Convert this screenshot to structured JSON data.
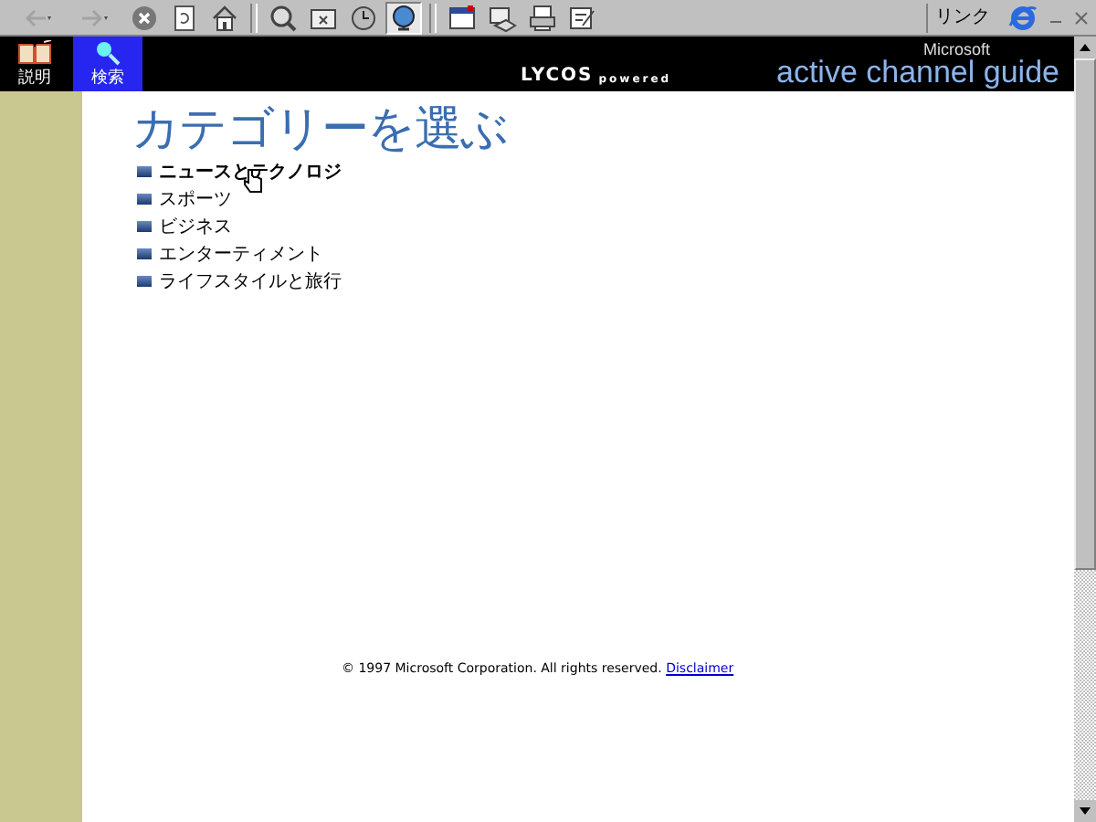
{
  "toolbar": {
    "buttons": [
      {
        "kind": "back",
        "disabled": true,
        "pressed": false
      },
      {
        "kind": "forward",
        "disabled": true,
        "pressed": false
      },
      {
        "kind": "stop",
        "disabled": false,
        "pressed": false
      },
      {
        "kind": "refresh",
        "disabled": false,
        "pressed": false
      },
      {
        "kind": "home",
        "disabled": false,
        "pressed": false
      },
      {
        "kind": "sep"
      },
      {
        "kind": "search",
        "disabled": false,
        "pressed": false
      },
      {
        "kind": "favorites",
        "disabled": false,
        "pressed": false
      },
      {
        "kind": "history",
        "disabled": false,
        "pressed": false
      },
      {
        "kind": "channels",
        "disabled": false,
        "pressed": true
      },
      {
        "kind": "sep"
      },
      {
        "kind": "fullscreen",
        "disabled": false,
        "pressed": false
      },
      {
        "kind": "mail",
        "disabled": false,
        "pressed": false
      },
      {
        "kind": "print",
        "disabled": false,
        "pressed": false
      },
      {
        "kind": "edit",
        "disabled": false,
        "pressed": false
      }
    ],
    "links_label": "リンク"
  },
  "explorer_bar": {
    "tabs": [
      {
        "label": "説明",
        "kind": "book",
        "selected": false
      },
      {
        "label": "検索",
        "kind": "search",
        "selected": true
      }
    ]
  },
  "header": {
    "logo_main": "LYCOS",
    "logo_sub": "powered",
    "brand": "Microsoft",
    "product": "active channel guide"
  },
  "page": {
    "title": "カテゴリーを選ぶ",
    "categories": [
      {
        "label": "ニュースとテクノロジ",
        "hovered": true
      },
      {
        "label": "スポーツ",
        "hovered": false
      },
      {
        "label": "ビジネス",
        "hovered": false
      },
      {
        "label": "エンターティメント",
        "hovered": false
      },
      {
        "label": "ライフスタイルと旅行",
        "hovered": false
      }
    ],
    "copyright": "© 1997 Microsoft Corporation. All rights reserved.",
    "disclaimer": "Disclaimer"
  }
}
